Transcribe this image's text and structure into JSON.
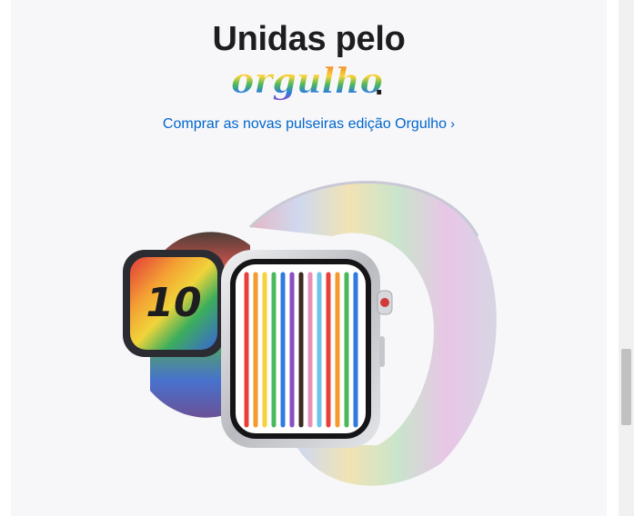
{
  "headline": "Unidas pelo",
  "script_word": "orgulho",
  "script_period": ".",
  "cta": {
    "label": "Comprar as novas pulseiras edição Orgulho",
    "chevron": "›"
  },
  "watch_small": {
    "face_number": "10"
  },
  "colors": {
    "background": "#f7f7f9",
    "headline": "#1d1d1f",
    "link": "#0066cc",
    "rainbow": [
      "#e8413a",
      "#f59a2e",
      "#f7d23a",
      "#4cb85c",
      "#2f7be0",
      "#8a4fc7"
    ]
  }
}
